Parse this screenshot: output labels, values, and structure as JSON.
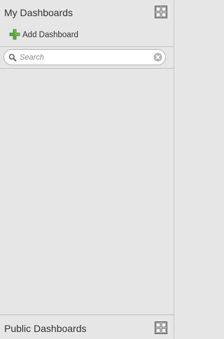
{
  "my_dashboards": {
    "title": "My Dashboards",
    "layout_icon": "grid-layout-icon",
    "add_label": "Add Dashboard",
    "add_icon": "plus-icon"
  },
  "search": {
    "placeholder": "Search",
    "value": "",
    "icon": "search-icon",
    "clear_icon": "clear-icon"
  },
  "public_dashboards": {
    "title": "Public Dashboards",
    "layout_icon": "grid-layout-icon"
  },
  "colors": {
    "panel_background": "#e6e6e6",
    "divider": "#c4c4c4",
    "add_icon_green": "#5aa93a",
    "text": "#333333"
  }
}
